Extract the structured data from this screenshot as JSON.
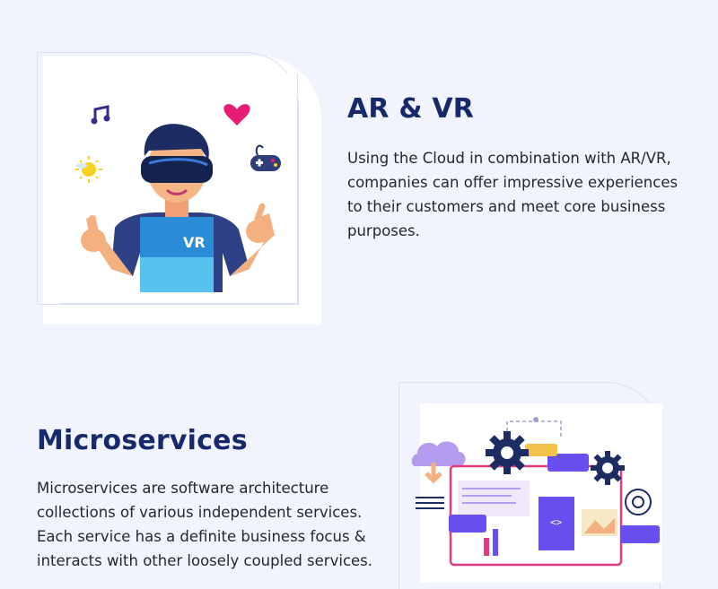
{
  "sections": [
    {
      "title": "AR & VR",
      "description": "Using the Cloud in combination with AR/VR, companies can offer impressive experiences to their customers and meet core business purposes."
    },
    {
      "title": "Microservices",
      "description": "Microservices are software architecture collections of various independent services. Each service has a definite business focus & interacts with other loosely coupled services."
    }
  ],
  "illustration": {
    "vr_headset_label": "VR"
  },
  "colors": {
    "background": "#f1f4fd",
    "heading": "#15296b",
    "body_text": "#24272e",
    "accent_purple": "#6a4ff0",
    "accent_dark": "#1d2d63"
  }
}
